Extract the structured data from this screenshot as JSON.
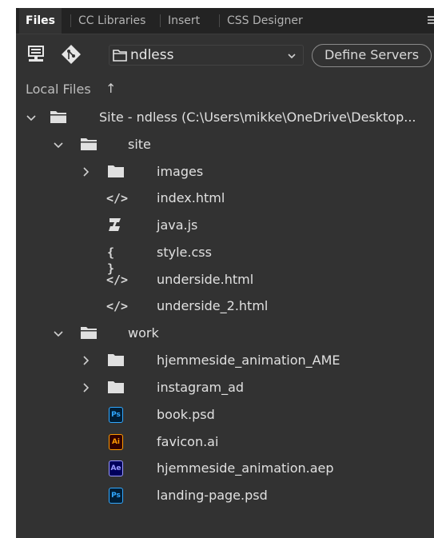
{
  "tabs": [
    {
      "label": "Files"
    },
    {
      "label": "CC Libraries"
    },
    {
      "label": "Insert"
    },
    {
      "label": "CSS Designer"
    }
  ],
  "toolbar": {
    "site_value": "ndless",
    "define_servers_label": "Define Servers"
  },
  "files_header": {
    "label": "Local Files",
    "sort_icon": "↑"
  },
  "tree": {
    "root": "Site - ndless (C:\\Users\\mikke\\OneDrive\\Desktop...",
    "site_folder": "site",
    "site_items": [
      "images",
      "index.html",
      "java.js",
      "style.css",
      "underside.html",
      "underside_2.html"
    ],
    "work_folder": "work",
    "work_items": [
      "hjemmeside_animation_AME",
      "instagram_ad",
      "book.psd",
      "favicon.ai",
      "hjemmeside_animation.aep",
      "landing-page.psd"
    ]
  },
  "icons": {
    "code": "</>",
    "css": "{ }",
    "ps": "Ps",
    "ai": "Ai",
    "ae": "Ae"
  },
  "colors": {
    "panel_bg": "#323232",
    "tabbar_bg": "#232323",
    "ps_accent": "#31a8ff",
    "ai_accent": "#ff9a00",
    "ae_accent": "#9999ff"
  }
}
